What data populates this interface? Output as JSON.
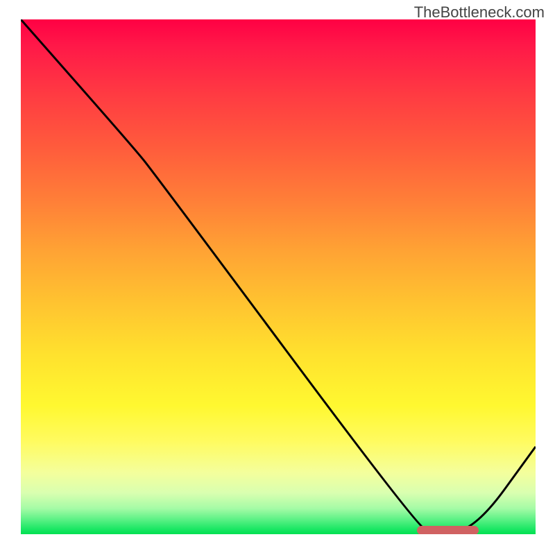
{
  "watermark": "TheBottleneck.com",
  "chart_data": {
    "type": "line",
    "title": "",
    "xlabel": "",
    "ylabel": "",
    "xlim": [
      0,
      100
    ],
    "ylim": [
      0,
      100
    ],
    "grid": false,
    "curve_points": [
      {
        "x": 0,
        "y": 100
      },
      {
        "x": 22,
        "y": 75
      },
      {
        "x": 26,
        "y": 70
      },
      {
        "x": 77,
        "y": 1.5
      },
      {
        "x": 80,
        "y": 0.5
      },
      {
        "x": 88,
        "y": 0.5
      },
      {
        "x": 100,
        "y": 17
      }
    ],
    "marker": {
      "x_start": 77,
      "x_end": 89,
      "y": 0.8,
      "color": "#d06262"
    },
    "gradient_colors": {
      "top": "#ff0044",
      "bottom": "#00e050"
    }
  }
}
